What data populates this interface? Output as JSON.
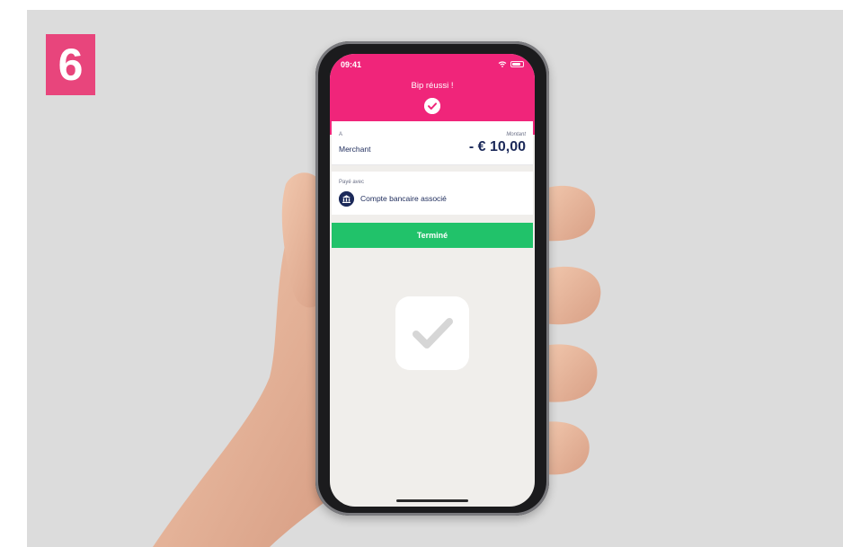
{
  "badge": {
    "step": "6"
  },
  "status_bar": {
    "time": "09:41",
    "icons": [
      "wifi-icon",
      "battery-icon"
    ]
  },
  "header": {
    "title": "Bip réussi !",
    "icon": "check-circle-icon"
  },
  "payment": {
    "recipient_label": "A",
    "recipient": "Merchant",
    "amount_label": "Montant",
    "amount": "- € 10,00"
  },
  "paid_with": {
    "label": "Payé avec",
    "icon": "bank-icon",
    "method": "Compte bancaire associé"
  },
  "actions": {
    "done_label": "Terminé"
  },
  "colors": {
    "brand_pink": "#f0257a",
    "badge_pink": "#e8457c",
    "success_green": "#21c26a",
    "navy_text": "#1c2a5a",
    "background": "#dcdcdc"
  }
}
